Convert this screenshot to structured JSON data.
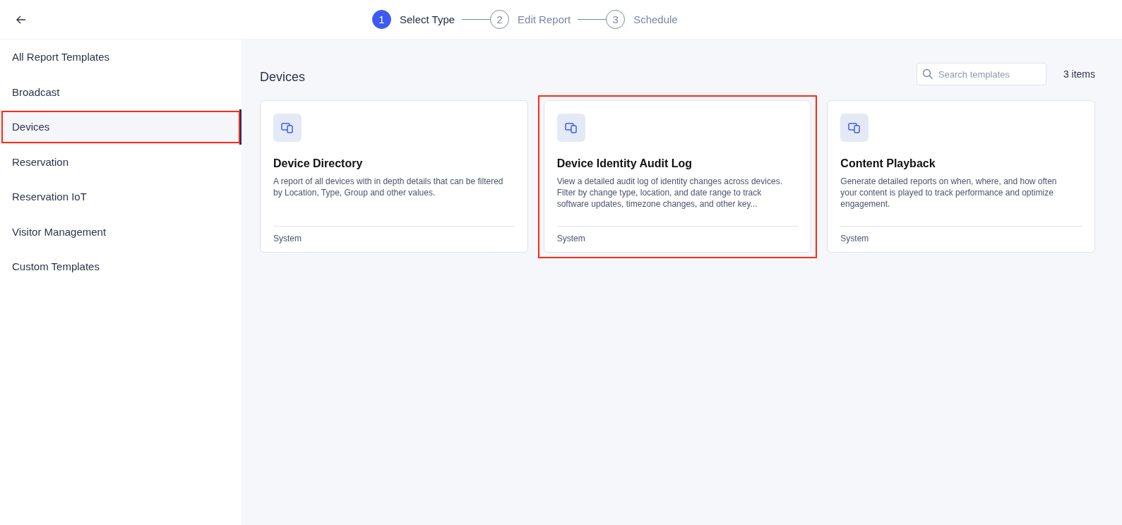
{
  "stepper": [
    {
      "number": "1",
      "label": "Select Type",
      "selected": true
    },
    {
      "number": "2",
      "label": "Edit Report",
      "selected": false
    },
    {
      "number": "3",
      "label": "Schedule",
      "selected": false
    }
  ],
  "sidebar": {
    "items": [
      {
        "label": "All Report Templates",
        "selected": false,
        "highlighted": false
      },
      {
        "label": "Broadcast",
        "selected": false,
        "highlighted": false
      },
      {
        "label": "Devices",
        "selected": true,
        "highlighted": true
      },
      {
        "label": "Reservation",
        "selected": false,
        "highlighted": false
      },
      {
        "label": "Reservation IoT",
        "selected": false,
        "highlighted": false
      },
      {
        "label": "Visitor Management",
        "selected": false,
        "highlighted": false
      },
      {
        "label": "Custom Templates",
        "selected": false,
        "highlighted": false
      }
    ]
  },
  "main": {
    "heading": "Devices",
    "search": {
      "placeholder": "Search templates"
    },
    "count": "3 items",
    "cards": [
      {
        "title": "Device Directory",
        "description": "A report of all devices with in depth details that can be filtered by Location, Type, Group and other values.",
        "footer": "System",
        "highlighted": false
      },
      {
        "title": "Device Identity Audit Log",
        "description": "View a detailed audit log of identity changes across devices. Filter by change type, location, and date range to track software updates, timezone changes, and other key...",
        "footer": "System",
        "highlighted": true
      },
      {
        "title": "Content Playback",
        "description": "Generate detailed reports on when, where, and how often your content is played to track performance and optimize engagement.",
        "footer": "System",
        "highlighted": false
      }
    ]
  }
}
